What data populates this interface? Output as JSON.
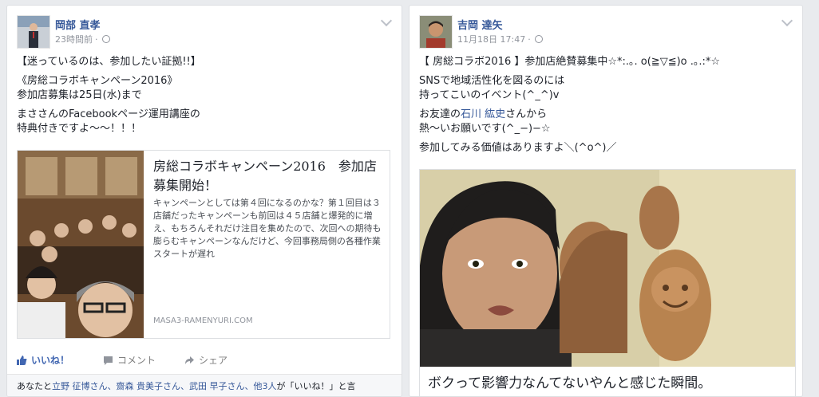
{
  "post1": {
    "author": "岡部 直孝",
    "time": "23時間前",
    "dot": "·",
    "lines": [
      "【迷っているのは、参加したい証拠!!】",
      "《房総コラボキャンペーン2016》",
      "参加店募集は25日(水)まで",
      "まささんのFacebookページ運用講座の",
      "特典付きですよ〜〜！！！"
    ],
    "share": {
      "title": "房総コラボキャンペーン2016　参加店募集開始！",
      "description": "キャンペーンとしては第４回になるのかな？第１回目は３店舗だったキャンペーンも前回は４５店舗と爆発的に増え、もちろんそれだけ注目を集めたので、次回への期待も膨らむキャンペーンなんだけど、今回事務局側の各種作業スタートが遅れ",
      "domain": "MASA3-RAMENYURI.COM"
    },
    "actions": {
      "like": "いいね！",
      "comment": "コメント",
      "share": "シェア"
    },
    "footer": {
      "prefix": "あなたと",
      "names": "立野 征博さん、齋森 貴美子さん、武田 早子さん、他3人",
      "suffix": "が「いいね！」と言"
    }
  },
  "post2": {
    "author": "吉岡 達矢",
    "time": "11月18日 17:47",
    "dot": "·",
    "line1": "【 房総コラボ2016 】参加店絶賛募集中☆*:.｡. o(≧▽≦)o .｡.:*☆",
    "line2": "SNSで地域活性化を図るのには",
    "line3": "持ってこいのイベント(^_^)v",
    "line4_pre": "お友達の",
    "line4_link": "石川 紘史",
    "line4_post": "さんから",
    "line5": "熱〜いお願いです(^_−)−☆",
    "line6": "参加してみる価値はありますよ＼(^o^)／",
    "caption": "ボクって影響力なんてないやんと感じた瞬間。"
  },
  "colors": {
    "link": "#365899",
    "like_blue": "#4267b2",
    "page_bg": "#e9ebee"
  }
}
